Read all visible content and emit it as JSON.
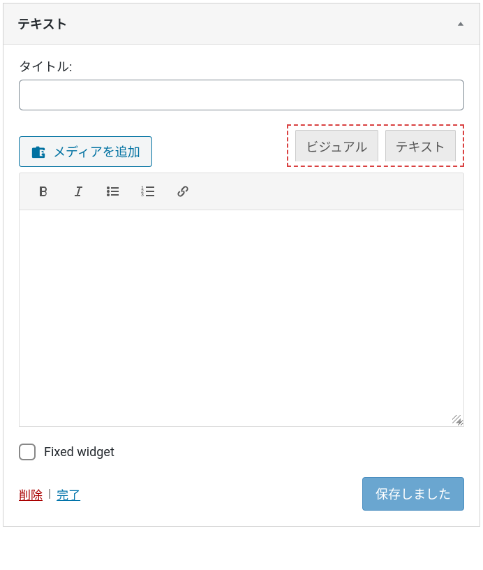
{
  "widget": {
    "header_title": "テキスト",
    "title_label": "タイトル:",
    "title_value": "",
    "title_placeholder": "",
    "media_button_label": "メディアを追加",
    "tabs": {
      "visual": "ビジュアル",
      "text": "テキスト"
    },
    "toolbar_icons": {
      "bold": "bold-icon",
      "italic": "italic-icon",
      "bullets": "bullet-list-icon",
      "numbered": "numbered-list-icon",
      "link": "link-icon"
    },
    "fixed_widget": {
      "label": "Fixed widget",
      "checked": false
    },
    "footer": {
      "delete_label": "削除",
      "separator": "|",
      "done_label": "完了",
      "saved_button_label": "保存しました"
    }
  }
}
